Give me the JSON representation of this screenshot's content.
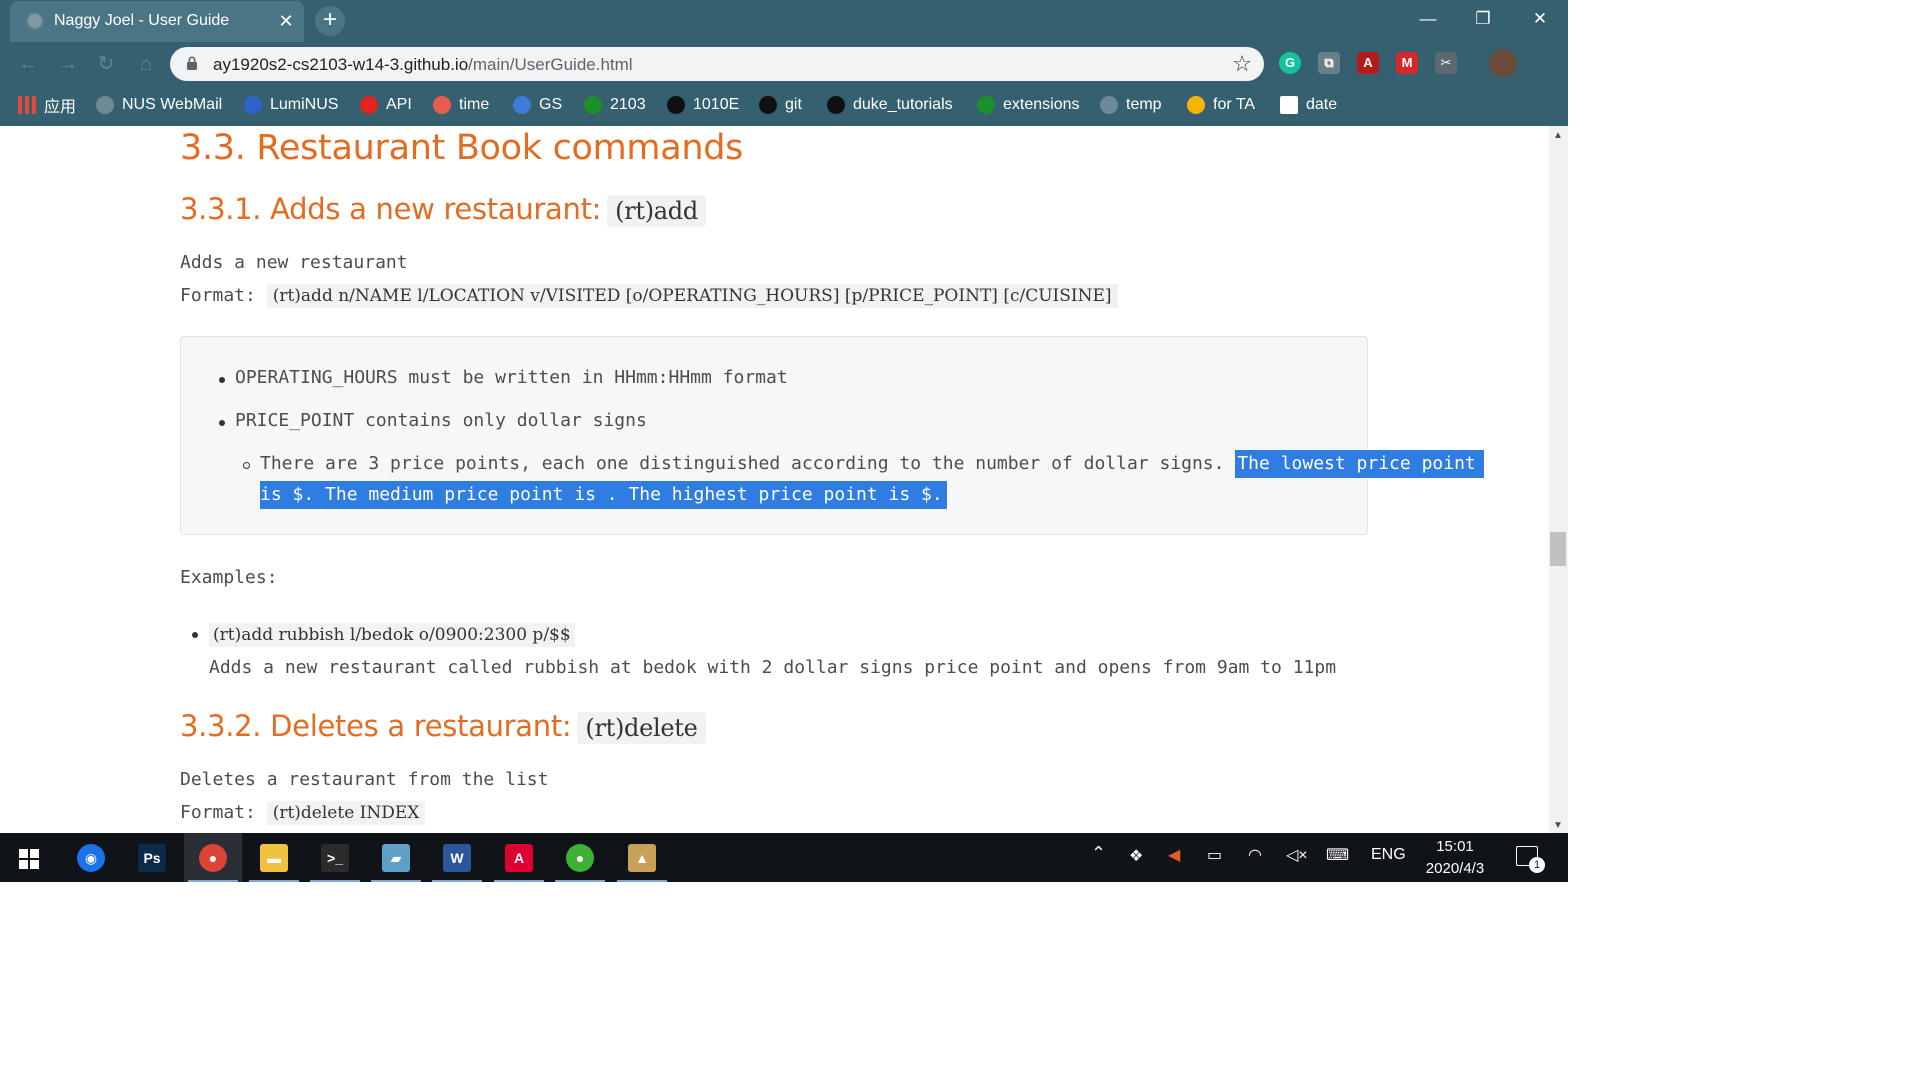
{
  "browser": {
    "tab_title": "Naggy Joel - User Guide",
    "close_tab_glyph": "✕",
    "new_tab_glyph": "+",
    "url_domain": "ay1920s2-cs2103-w14-3.github.io",
    "url_path": "/main/UserGuide.html",
    "window_controls": {
      "minimize": "—",
      "restore": "❐",
      "close": "✕"
    },
    "bookmarks": [
      {
        "label": "应用",
        "icon": "apps-grid-icon",
        "color": "#e8453c"
      },
      {
        "label": "NUS WebMail",
        "icon": "globe-icon",
        "color": "#6f8a95"
      },
      {
        "label": "LumiNUS",
        "icon": "luminus-icon",
        "color": "#2e63c9"
      },
      {
        "label": "API",
        "icon": "oracle-icon",
        "color": "#e52321"
      },
      {
        "label": "time",
        "icon": "m-icon",
        "color": "#e85d4a"
      },
      {
        "label": "GS",
        "icon": "gs-icon",
        "color": "#3d7bd9"
      },
      {
        "label": "2103",
        "icon": "leaf-icon",
        "color": "#1d8f2a"
      },
      {
        "label": "1010E",
        "icon": "dark-badge-icon",
        "color": "#111111"
      },
      {
        "label": "git",
        "icon": "github-icon",
        "color": "#111111"
      },
      {
        "label": "duke_tutorials",
        "icon": "github-icon",
        "color": "#111111"
      },
      {
        "label": "extensions",
        "icon": "leaf-icon",
        "color": "#1d8f2a"
      },
      {
        "label": "temp",
        "icon": "globe-icon",
        "color": "#6f8a95"
      },
      {
        "label": "for TA",
        "icon": "drive-icon",
        "color": "#f4b400"
      },
      {
        "label": "date",
        "icon": "j-icon",
        "color": "#111111"
      }
    ],
    "extensions": [
      {
        "name": "grammarly-icon",
        "glyph": "G",
        "color": "#15c39a"
      },
      {
        "name": "copy-extension-icon",
        "glyph": "⧉",
        "color": "#6a7f88"
      },
      {
        "name": "pdf-icon",
        "glyph": "A",
        "color": "#b41c1c"
      },
      {
        "name": "mendeley-icon",
        "glyph": "M",
        "color": "#d62828"
      },
      {
        "name": "screenshot-icon",
        "glyph": "✂",
        "color": "#5c6a70"
      }
    ]
  },
  "doc": {
    "section_title": "3.3. Restaurant Book commands",
    "add": {
      "heading": "3.3.1. Adds a new restaurant:",
      "heading_code": "(rt)add",
      "description": "Adds a new restaurant",
      "format_label": "Format:",
      "format_code": "(rt)add n/NAME l/LOCATION v/VISITED [o/OPERATING_HOURS] [p/PRICE_POINT] [c/CUISINE]",
      "tips": [
        "OPERATING_HOURS must be written in HHmm:HHmm format",
        "PRICE_POINT contains only dollar signs"
      ],
      "subtip_plain": "There are 3 price points, each one distinguished according to the number of dollar signs.",
      "subtip_selected_1": "The lowest price point",
      "subtip_selected_2": "is $. The medium price point is . The highest price point is $.",
      "examples_label": "Examples:",
      "example_code": "(rt)add rubbish l/bedok o/0900:2300 p/$$",
      "example_desc": "Adds a new restaurant called rubbish at bedok with 2 dollar signs price point and opens from 9am to 11pm"
    },
    "delete": {
      "heading": "3.3.2. Deletes a restaurant:",
      "heading_code": "(rt)delete",
      "description": "Deletes a restaurant from the list",
      "format_label": "Format:",
      "format_code": "(rt)delete INDEX"
    }
  },
  "taskbar": {
    "apps": [
      {
        "name": "maps-app-icon",
        "glyph": "◉",
        "color": "#1a73e8"
      },
      {
        "name": "photoshop-app-icon",
        "glyph": "Ps",
        "color": "#0e2a4a"
      },
      {
        "name": "chrome-app-icon",
        "glyph": "●",
        "color": "#db4437"
      },
      {
        "name": "file-explorer-app-icon",
        "glyph": "▬",
        "color": "#f0c240"
      },
      {
        "name": "terminal-app-icon",
        "glyph": ">_",
        "color": "#2b2b2b"
      },
      {
        "name": "notes-app-icon",
        "glyph": "▰",
        "color": "#5fa0c8"
      },
      {
        "name": "word-app-icon",
        "glyph": "W",
        "color": "#2b579a"
      },
      {
        "name": "angular-app-icon",
        "glyph": "A",
        "color": "#dd0031"
      },
      {
        "name": "wechat-app-icon",
        "glyph": "●",
        "color": "#3eb034"
      },
      {
        "name": "contacts-app-icon",
        "glyph": "▲",
        "color": "#c7a05a"
      }
    ],
    "language": "ENG",
    "time": "15:01",
    "date": "2020/4/3",
    "notification_count": "1"
  }
}
